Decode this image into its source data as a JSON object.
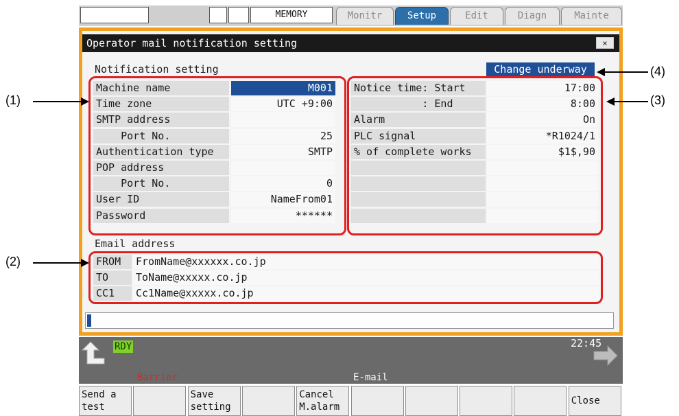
{
  "top_bar": {
    "box1": "",
    "box2": "",
    "box3": "",
    "mode": "MEMORY",
    "tabs": [
      {
        "label": "Monitr",
        "active": false
      },
      {
        "label": "Setup",
        "active": true
      },
      {
        "label": "Edit",
        "active": false
      },
      {
        "label": "Diagn",
        "active": false
      },
      {
        "label": "Mainte",
        "active": false
      }
    ]
  },
  "window": {
    "title": "Operator mail notification setting",
    "close_label": "×",
    "notification_heading": "Notification setting",
    "status_badge": "Change underway",
    "left_rows": [
      {
        "label": "Machine name",
        "value": "M001",
        "selected": true
      },
      {
        "label": "Time zone",
        "value": "UTC +9:00"
      },
      {
        "label": "SMTP address",
        "value": ""
      },
      {
        "label": "    Port No.",
        "value": "25"
      },
      {
        "label": "Authentication type",
        "value": "SMTP"
      },
      {
        "label": "POP address",
        "value": ""
      },
      {
        "label": "    Port No.",
        "value": "0"
      },
      {
        "label": "User ID",
        "value": "NameFrom01"
      },
      {
        "label": "Password",
        "value": "******"
      }
    ],
    "right_rows": [
      {
        "label": "Notice time: Start",
        "value": "17:00"
      },
      {
        "label": "           : End",
        "value": "8:00"
      },
      {
        "label": "Alarm",
        "value": "On"
      },
      {
        "label": "PLC signal",
        "value": "*R1024/1"
      },
      {
        "label": "% of complete works",
        "value": "$1$,90"
      },
      {
        "label": "",
        "value": ""
      },
      {
        "label": "",
        "value": ""
      },
      {
        "label": "",
        "value": ""
      },
      {
        "label": "",
        "value": ""
      }
    ],
    "email_heading": "Email address",
    "emails": [
      {
        "type": "FROM",
        "address": "FromName@xxxxxx.co.jp"
      },
      {
        "type": "TO",
        "address": "ToName@xxxxx.co.jp"
      },
      {
        "type": "CC1",
        "address": "Cc1Name@xxxxx.co.jp"
      }
    ],
    "input_value": ""
  },
  "callouts": [
    "(1)",
    "(2)",
    "(3)",
    "(4)"
  ],
  "status": {
    "ready": "RDY",
    "time": "22:45",
    "left_label": "Barrier",
    "center_label": "E-mail"
  },
  "function_keys": [
    {
      "line1": "Send a",
      "line2": "test"
    },
    {
      "line1": "",
      "line2": ""
    },
    {
      "line1": "Save",
      "line2": "setting"
    },
    {
      "line1": "",
      "line2": ""
    },
    {
      "line1": "Cancel",
      "line2": "M.alarm"
    },
    {
      "line1": "",
      "line2": ""
    },
    {
      "line1": "",
      "line2": ""
    },
    {
      "line1": "",
      "line2": ""
    },
    {
      "line1": "",
      "line2": ""
    },
    {
      "line1": "",
      "line2": "Close"
    }
  ],
  "colors": {
    "frame": "#f2a020",
    "highlight": "#e02020",
    "selection": "#1f4f96",
    "active_tab": "#2d6fa8",
    "ready": "#7fd02a",
    "barrier_text": "#c43030"
  }
}
